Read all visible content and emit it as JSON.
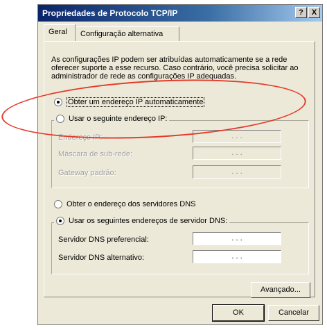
{
  "window": {
    "title": "Propriedades de Protocolo TCP/IP",
    "help_label": "?",
    "close_label": "X"
  },
  "tabs": [
    {
      "label": "Geral",
      "active": true
    },
    {
      "label": "Configuração alternativa",
      "active": false
    }
  ],
  "description": "As configurações IP podem ser atribuídas automaticamente se a rede oferecer suporte a esse recurso. Caso contrário, você precisa solicitar ao administrador de rede as configurações IP adequadas.",
  "ip": {
    "auto_label": "Obter um endereço IP automaticamente",
    "auto_checked": true,
    "manual_label": "Usar o seguinte endereço IP:",
    "manual_checked": false,
    "fields": [
      {
        "label": "Endereço IP:",
        "value": ". . ."
      },
      {
        "label": "Máscara de sub-rede:",
        "value": ". . ."
      },
      {
        "label": "Gateway padrão:",
        "value": ". . ."
      }
    ]
  },
  "dns": {
    "auto_label": "Obter o endereço dos servidores DNS",
    "auto_checked": false,
    "manual_label": "Usar os seguintes endereços de servidor DNS:",
    "manual_checked": true,
    "fields": [
      {
        "label": "Servidor DNS preferencial:",
        "value": ". . ."
      },
      {
        "label": "Servidor DNS alternativo:",
        "value": ". . ."
      }
    ]
  },
  "buttons": {
    "advanced": "Avançado...",
    "ok": "OK",
    "cancel": "Cancelar"
  },
  "colors": {
    "titlebar": "#0a246a",
    "dialog_bg": "#ece9d8",
    "highlight_ellipse": "#e53a2a"
  }
}
